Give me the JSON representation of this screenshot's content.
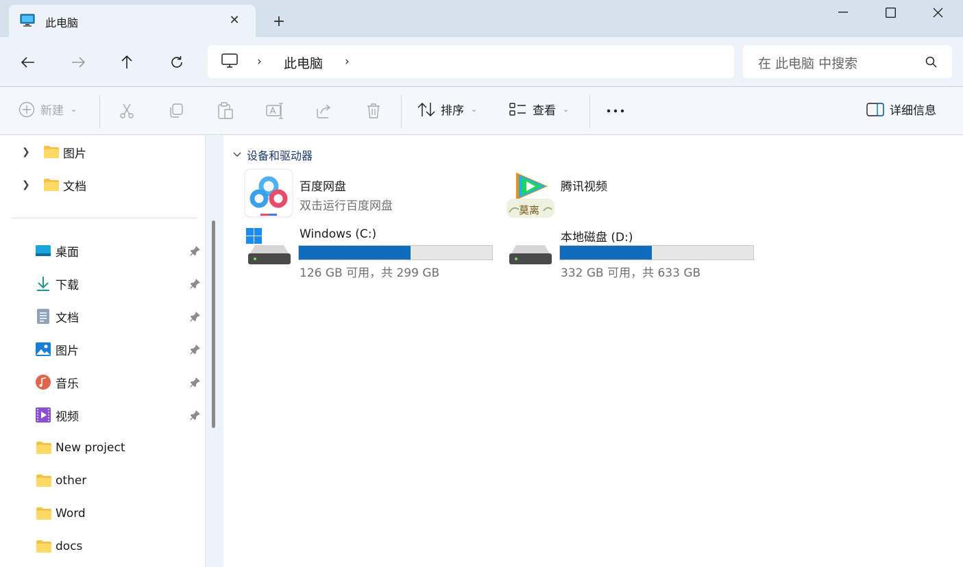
{
  "window": {
    "tab_title": "此电脑",
    "colors": {
      "accent": "#0f6cbd",
      "group_header": "#1b3a73"
    }
  },
  "address": {
    "location": "此电脑",
    "search_placeholder": "在 此电脑 中搜索"
  },
  "toolbar": {
    "new_label": "新建",
    "sort_label": "排序",
    "view_label": "查看",
    "details_label": "详细信息"
  },
  "sidebar": {
    "tree": [
      {
        "label": "图片",
        "icon": "folder-icon"
      },
      {
        "label": "文档",
        "icon": "folder-icon"
      }
    ],
    "quick_access": [
      {
        "label": "桌面",
        "icon": "desktop-icon",
        "pinned": true
      },
      {
        "label": "下载",
        "icon": "download-icon",
        "pinned": true
      },
      {
        "label": "文档",
        "icon": "documents-icon",
        "pinned": true
      },
      {
        "label": "图片",
        "icon": "pictures-icon",
        "pinned": true
      },
      {
        "label": "音乐",
        "icon": "music-icon",
        "pinned": true
      },
      {
        "label": "视频",
        "icon": "videos-icon",
        "pinned": true
      },
      {
        "label": "New project",
        "icon": "folder-icon",
        "pinned": false
      },
      {
        "label": "other",
        "icon": "folder-icon",
        "pinned": false
      },
      {
        "label": "Word",
        "icon": "folder-icon",
        "pinned": false
      },
      {
        "label": "docs",
        "icon": "folder-icon",
        "pinned": false
      }
    ]
  },
  "main": {
    "group_title": "设备和驱动器",
    "apps": [
      {
        "name": "百度网盘",
        "subtitle": "双击运行百度网盘",
        "icon": "baidu-netdisk-icon"
      },
      {
        "name": "腾讯视频",
        "subtitle": "",
        "icon": "tencent-video-icon",
        "badge": "莫离"
      }
    ],
    "drives": [
      {
        "name": "Windows (C:)",
        "usage_text": "126 GB 可用，共 299 GB",
        "used_fraction": 0.579,
        "icon": "windows-drive-icon"
      },
      {
        "name": "本地磁盘 (D:)",
        "usage_text": "332 GB 可用，共 633 GB",
        "used_fraction": 0.476,
        "icon": "hard-drive-icon"
      }
    ]
  }
}
